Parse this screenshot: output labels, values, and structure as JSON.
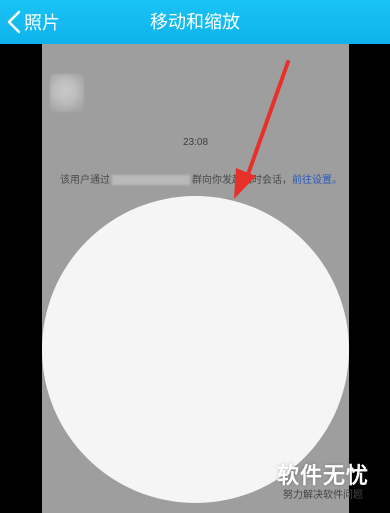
{
  "header": {
    "back_label": "照片",
    "title": "移动和缩放"
  },
  "chat": {
    "time": "23:08",
    "system_message_prefix": "该用户通过",
    "system_message_middle": "群向你发起临时会话，",
    "system_message_link": "前往设置。"
  },
  "watermark": {
    "title": "软件无忧",
    "subtitle": "努力解决软件问题"
  },
  "colors": {
    "topbar": "#13b9f0",
    "arrow": "#e8302b",
    "circle": "#f5f5f5"
  }
}
